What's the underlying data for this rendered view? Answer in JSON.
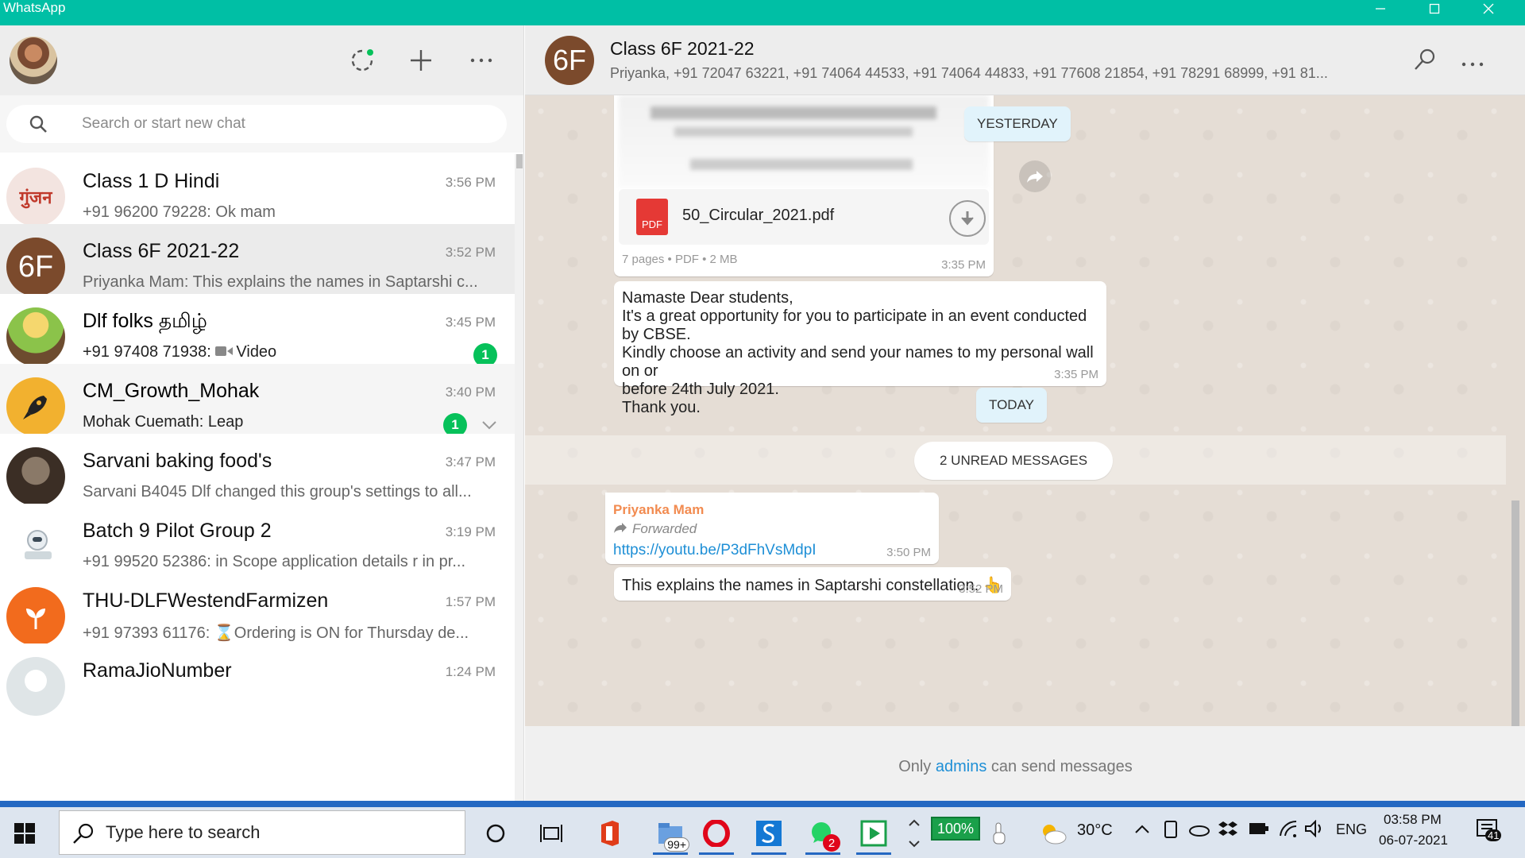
{
  "window": {
    "title": "WhatsApp"
  },
  "left": {
    "search": {
      "placeholder": "Search or start new chat"
    },
    "chats": [
      {
        "name": "Class 1 D Hindi",
        "time": "3:56 PM",
        "preview": "+91 96200 79228: Ok mam",
        "avatar_text": "गुंजन",
        "avatar_color": "#f3e4e0",
        "unread": ""
      },
      {
        "name": "Class 6F 2021-22",
        "time": "3:52 PM",
        "preview": "Priyanka Mam: This explains the names in  Saptarshi c...",
        "avatar_text": "6F",
        "avatar_color": "#7b4a2c",
        "unread": ""
      },
      {
        "name": "Dlf folks தமிழ்",
        "time": "3:45 PM",
        "preview_sender": "+91 97408 71938: ",
        "preview": "Video",
        "avatar_text": "",
        "avatar_color": "#8bc34a",
        "unread": "1"
      },
      {
        "name": "CM_Growth_Mohak",
        "time": "3:40 PM",
        "preview": "Mohak Cuemath: Leap",
        "avatar_text": "",
        "avatar_color": "#f2b12f",
        "unread": "1"
      },
      {
        "name": "Sarvani baking food's",
        "time": "3:47 PM",
        "preview": "Sarvani B4045 Dlf changed this group's settings to all...",
        "avatar_text": "",
        "avatar_color": "#5a4a3e",
        "unread": ""
      },
      {
        "name": "Batch 9 Pilot Group 2",
        "time": "3:19 PM",
        "preview": "+91 99520 52386: in Scope application details r in pr...",
        "avatar_text": "",
        "avatar_color": "#eef2f5",
        "unread": ""
      },
      {
        "name": "THU-DLFWestendFarmizen",
        "time": "1:57 PM",
        "preview": "+91 97393 61176: ⌛Ordering is ON for Thursday de...",
        "avatar_text": "",
        "avatar_color": "#f26b1d",
        "unread": ""
      },
      {
        "name": "RamaJioNumber",
        "time": "1:24 PM",
        "preview": "",
        "avatar_text": "",
        "avatar_color": "#dfe5e7",
        "unread": ""
      }
    ]
  },
  "conversation": {
    "title": "Class 6F 2021-22",
    "avatar_text": "6F",
    "members": "Priyanka, +91 72047 63221, +91 74064 44533, +91 74064 44833, +91 77608 21854, +91 78291 68999, +91 81...",
    "date_yesterday": "YESTERDAY",
    "date_today": "TODAY",
    "unread_banner": "2 UNREAD MESSAGES",
    "doc": {
      "pdf_label": "PDF",
      "filename": "50_Circular_2021.pdf",
      "meta": "7 pages • PDF • 2 MB",
      "time": "3:35 PM"
    },
    "message1": {
      "lines": [
        "Namaste Dear students,",
        "It's a great opportunity for you to participate in an event conducted by CBSE.",
        "Kindly choose an activity and send your names to my personal wall on or",
        "before 24th July 2021.",
        "Thank you."
      ],
      "time": "3:35 PM"
    },
    "message2": {
      "sender": "Priyanka Mam",
      "forwarded": "Forwarded",
      "link": "https://youtu.be/P3dFhVsMdpI",
      "time": "3:50 PM"
    },
    "message3": {
      "text": "This explains the names in  Saptarshi constellation. 👆",
      "time": "3:52 PM"
    },
    "footer": {
      "prefix": "Only ",
      "link": "admins",
      "suffix": " can send messages"
    }
  },
  "taskbar": {
    "search_placeholder": "Type here to search",
    "badge_99": "99+",
    "whatsapp_badge": "2",
    "battery_percent": "100%",
    "temperature": "30°C",
    "language": "ENG",
    "time": "03:58 PM",
    "date": "06-07-2021",
    "notifications": "41"
  },
  "colors": {
    "titlebar": "#00bfa5",
    "accent_green": "#06c15a",
    "link": "#1e8fd6",
    "sender": "#f28b50"
  }
}
